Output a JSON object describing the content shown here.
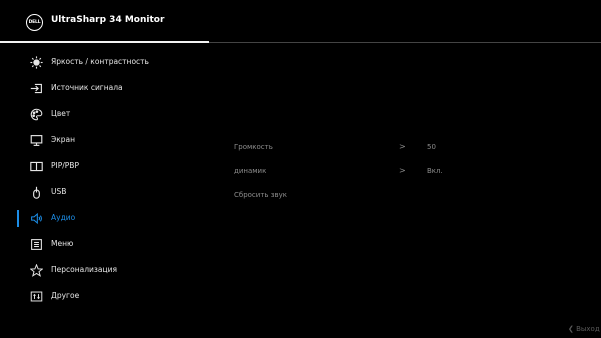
{
  "header": {
    "logo_text": "DELL",
    "title": "UltraSharp 34 Monitor"
  },
  "menu": {
    "items": [
      {
        "label": "Яркость / контрастность",
        "icon": "brightness-icon"
      },
      {
        "label": "Источник сигнала",
        "icon": "input-source-icon"
      },
      {
        "label": "Цвет",
        "icon": "color-palette-icon"
      },
      {
        "label": "Экран",
        "icon": "display-monitor-icon"
      },
      {
        "label": "PIP/PBP",
        "icon": "pip-pbp-icon"
      },
      {
        "label": "USB",
        "icon": "usb-icon"
      },
      {
        "label": "Аудио",
        "icon": "speaker-icon",
        "active": true
      },
      {
        "label": "Меню",
        "icon": "menu-list-icon"
      },
      {
        "label": "Персонализация",
        "icon": "star-icon"
      },
      {
        "label": "Другое",
        "icon": "other-settings-icon"
      }
    ]
  },
  "submenu": {
    "rows": [
      {
        "name": "Громкость",
        "arrow": ">",
        "value": "50"
      },
      {
        "name": "динамик",
        "arrow": ">",
        "value": "Вкл."
      },
      {
        "name": "Сбросить звук",
        "arrow": "",
        "value": ""
      }
    ]
  },
  "footer": {
    "exit_label": "❮ Выход"
  },
  "colors": {
    "background": "#000000",
    "accent": "#1c8ee8",
    "text": "#e6e6e6",
    "dim_text": "#8c8c8c"
  }
}
